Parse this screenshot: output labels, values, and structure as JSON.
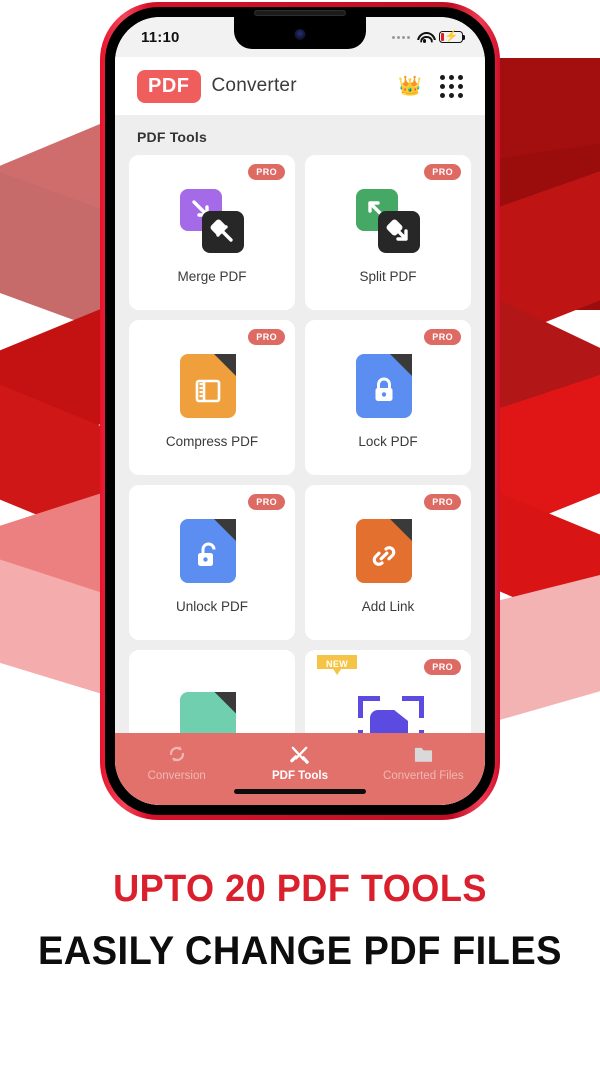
{
  "status_bar": {
    "time": "11:10",
    "signal_icon": "signal-dots-icon",
    "wifi_icon": "wifi-icon",
    "battery_icon": "battery-charging-icon"
  },
  "header": {
    "logo_text": "PDF",
    "title": "Converter",
    "crown_icon": "crown-icon",
    "grid_icon": "app-grid-icon",
    "logo_color": "#ef5d5d"
  },
  "content": {
    "section_title": "PDF Tools",
    "pro_badge": "PRO",
    "new_badge": "NEW",
    "tools": [
      {
        "label": "Merge PDF",
        "icon": "merge-pdf-icon",
        "badge": "PRO",
        "color": "#a46ae8"
      },
      {
        "label": "Split PDF",
        "icon": "split-pdf-icon",
        "badge": "PRO",
        "color": "#45a864"
      },
      {
        "label": "Compress PDF",
        "icon": "compress-pdf-icon",
        "badge": "PRO",
        "color": "#efa03c"
      },
      {
        "label": "Lock PDF",
        "icon": "lock-pdf-icon",
        "badge": "PRO",
        "color": "#5b8ef0"
      },
      {
        "label": "Unlock PDF",
        "icon": "unlock-pdf-icon",
        "badge": "PRO",
        "color": "#5b8ef0"
      },
      {
        "label": "Add Link",
        "icon": "add-link-icon",
        "badge": "PRO",
        "color": "#e4702f"
      },
      {
        "label": "",
        "icon": "green-doc-icon",
        "badge": "",
        "color": "#6fcfae"
      },
      {
        "label": "",
        "icon": "crop-pdf-icon",
        "badge": "PRO",
        "color": "#5b4be0"
      }
    ]
  },
  "bottom_nav": {
    "items": [
      {
        "label": "Conversion",
        "icon": "refresh-icon",
        "active": false
      },
      {
        "label": "PDF Tools",
        "icon": "tools-icon",
        "active": true
      },
      {
        "label": "Converted Files",
        "icon": "folder-icon",
        "active": false
      }
    ],
    "background_color": "#e2716c"
  },
  "captions": {
    "line1": "UPTO 20 PDF TOOLS",
    "line2": "EASILY CHANGE PDF FILES",
    "line1_color": "#da1f2d",
    "line2_color": "#0d0d0d"
  }
}
